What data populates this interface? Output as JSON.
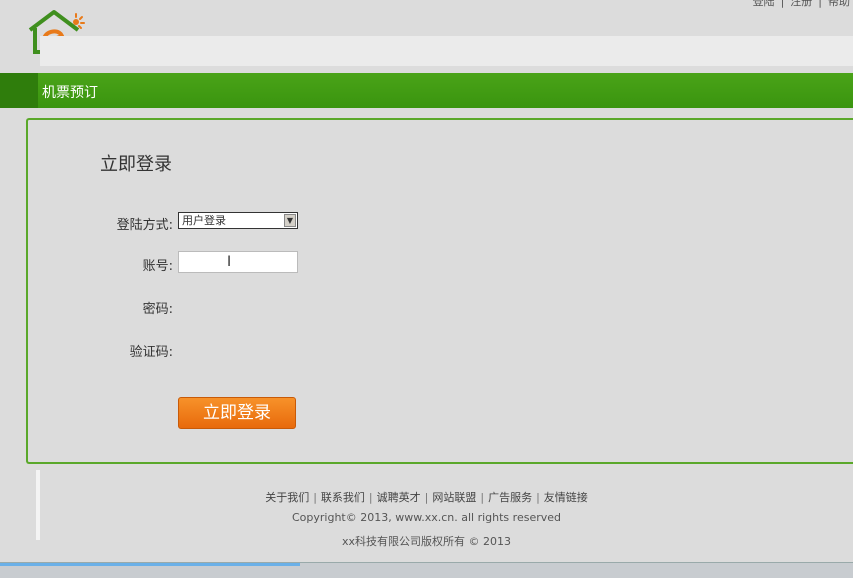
{
  "top_links": [
    "登陆",
    "|",
    "注册",
    "|",
    "帮助"
  ],
  "logo": {
    "icon": "house-e-logo",
    "colors": {
      "house": "#3f8f1e",
      "letter": "#e87a1a"
    }
  },
  "navbar": {
    "label": "机票预订",
    "color": "#45a016"
  },
  "login": {
    "title": "立即登录",
    "method_label": "登陆方式:",
    "method_value": "用户登录",
    "account_label": "账号:",
    "account_value": "",
    "password_label": "密码:",
    "captcha_label": "验证码:",
    "submit_label": "立即登录"
  },
  "footer": {
    "links": [
      "关于我们",
      "联系我们",
      "诚聘英才",
      "网站联盟",
      "广告服务",
      "友情链接"
    ],
    "copyright": "Copyright© 2013, www.xx.cn. all rights reserved",
    "company": "xx科技有限公司版权所有 © 2013"
  }
}
